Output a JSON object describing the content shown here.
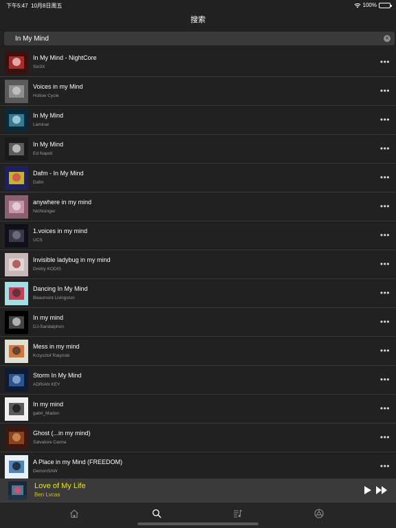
{
  "status": {
    "time": "下午5:47",
    "date": "10月8日周五",
    "battery": "100%"
  },
  "nav": {
    "title": "搜索"
  },
  "search": {
    "query": "In My Mind",
    "clear": "×"
  },
  "results": [
    {
      "title": "In My Mind - NightCore",
      "artist": "Sin3X"
    },
    {
      "title": "Voices in my Mind",
      "artist": "Hollow Cycle"
    },
    {
      "title": "In My Mind",
      "artist": "Laminar"
    },
    {
      "title": "In My Mind",
      "artist": "Ed Napoli"
    },
    {
      "title": "Dafm - In My Mind",
      "artist": "Dafm"
    },
    {
      "title": "anywhere in my mind",
      "artist": "Nichtsinger"
    },
    {
      "title": "1.voices in my mind",
      "artist": "UCS"
    },
    {
      "title": "Invisible ladybug in my mind",
      "artist": "Dmitry KODIS"
    },
    {
      "title": "Dancing In My Mind",
      "artist": "Beaumont Livingston"
    },
    {
      "title": "In my mind",
      "artist": "DJ-Sandalphon"
    },
    {
      "title": "Mess in my mind",
      "artist": "Krzysztof Ratynski"
    },
    {
      "title": "Storm In My Mind",
      "artist": "ADRIAN KEY"
    },
    {
      "title": "In my mind",
      "artist": "gabri_Madon"
    },
    {
      "title": "Ghost (...in my mind)",
      "artist": "Salvatore Canna"
    },
    {
      "title": "A Place in my Mind (FREEDOM)",
      "artist": "DemonSAW"
    }
  ],
  "more_label": "•••",
  "now_playing": {
    "title": "Love of My Life",
    "artist": "Ben Lvcas"
  },
  "tabs": [
    {
      "icon": "home-icon"
    },
    {
      "icon": "search-icon"
    },
    {
      "icon": "playlist-icon"
    },
    {
      "icon": "settings-icon"
    }
  ],
  "colors": {
    "background": "#212121",
    "accent": "#e6e600",
    "divider": "#3a3a3a",
    "active_tab": "#ffffff",
    "inactive_tab": "#8e8e8e"
  }
}
